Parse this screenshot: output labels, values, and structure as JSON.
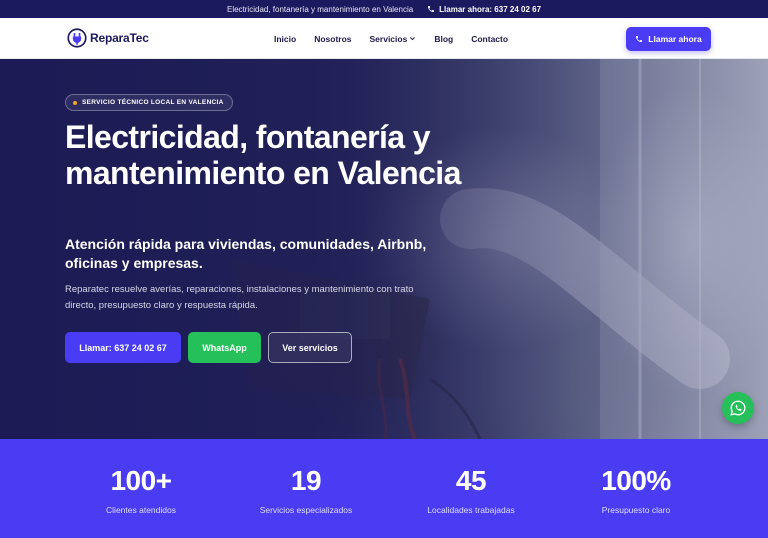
{
  "topbar": {
    "tagline": "Electricidad, fontanería y mantenimiento en Valencia",
    "phone_label": "Llamar ahora: 637 24 02 67",
    "phone_icon": "phone-icon"
  },
  "header": {
    "brand": "ReparaTec",
    "logo_icon": "plug-logo-icon",
    "nav": [
      {
        "label": "Inicio"
      },
      {
        "label": "Nosotros"
      },
      {
        "label": "Servicios",
        "dropdown": true
      },
      {
        "label": "Blog"
      },
      {
        "label": "Contacto"
      }
    ],
    "cta_label": "Llamar ahora"
  },
  "hero": {
    "badge": "SERVICIO TÉCNICO LOCAL EN VALENCIA",
    "title": "Electricidad, fontanería y mantenimiento en Valencia",
    "subtitle": "Atención rápida para viviendas, comunidades, Airbnb, oficinas y empresas.",
    "description": "Reparatec resuelve averías, reparaciones, instalaciones y mantenimiento con trato directo, presupuesto claro y respuesta rápida.",
    "buttons": {
      "call": "Llamar: 637 24 02 67",
      "whatsapp": "WhatsApp",
      "services": "Ver servicios"
    }
  },
  "floating": {
    "whatsapp_icon": "whatsapp-icon"
  },
  "stats": [
    {
      "value": "100+",
      "label": "Clientes atendidos"
    },
    {
      "value": "19",
      "label": "Servicios especializados"
    },
    {
      "value": "45",
      "label": "Localidades trabajadas"
    },
    {
      "value": "100%",
      "label": "Presupuesto claro"
    }
  ],
  "colors": {
    "primary": "#4a3cf2",
    "dark_navy": "#1c1a5e",
    "whatsapp_green": "#25c05a",
    "accent_dot": "#f5a623"
  }
}
